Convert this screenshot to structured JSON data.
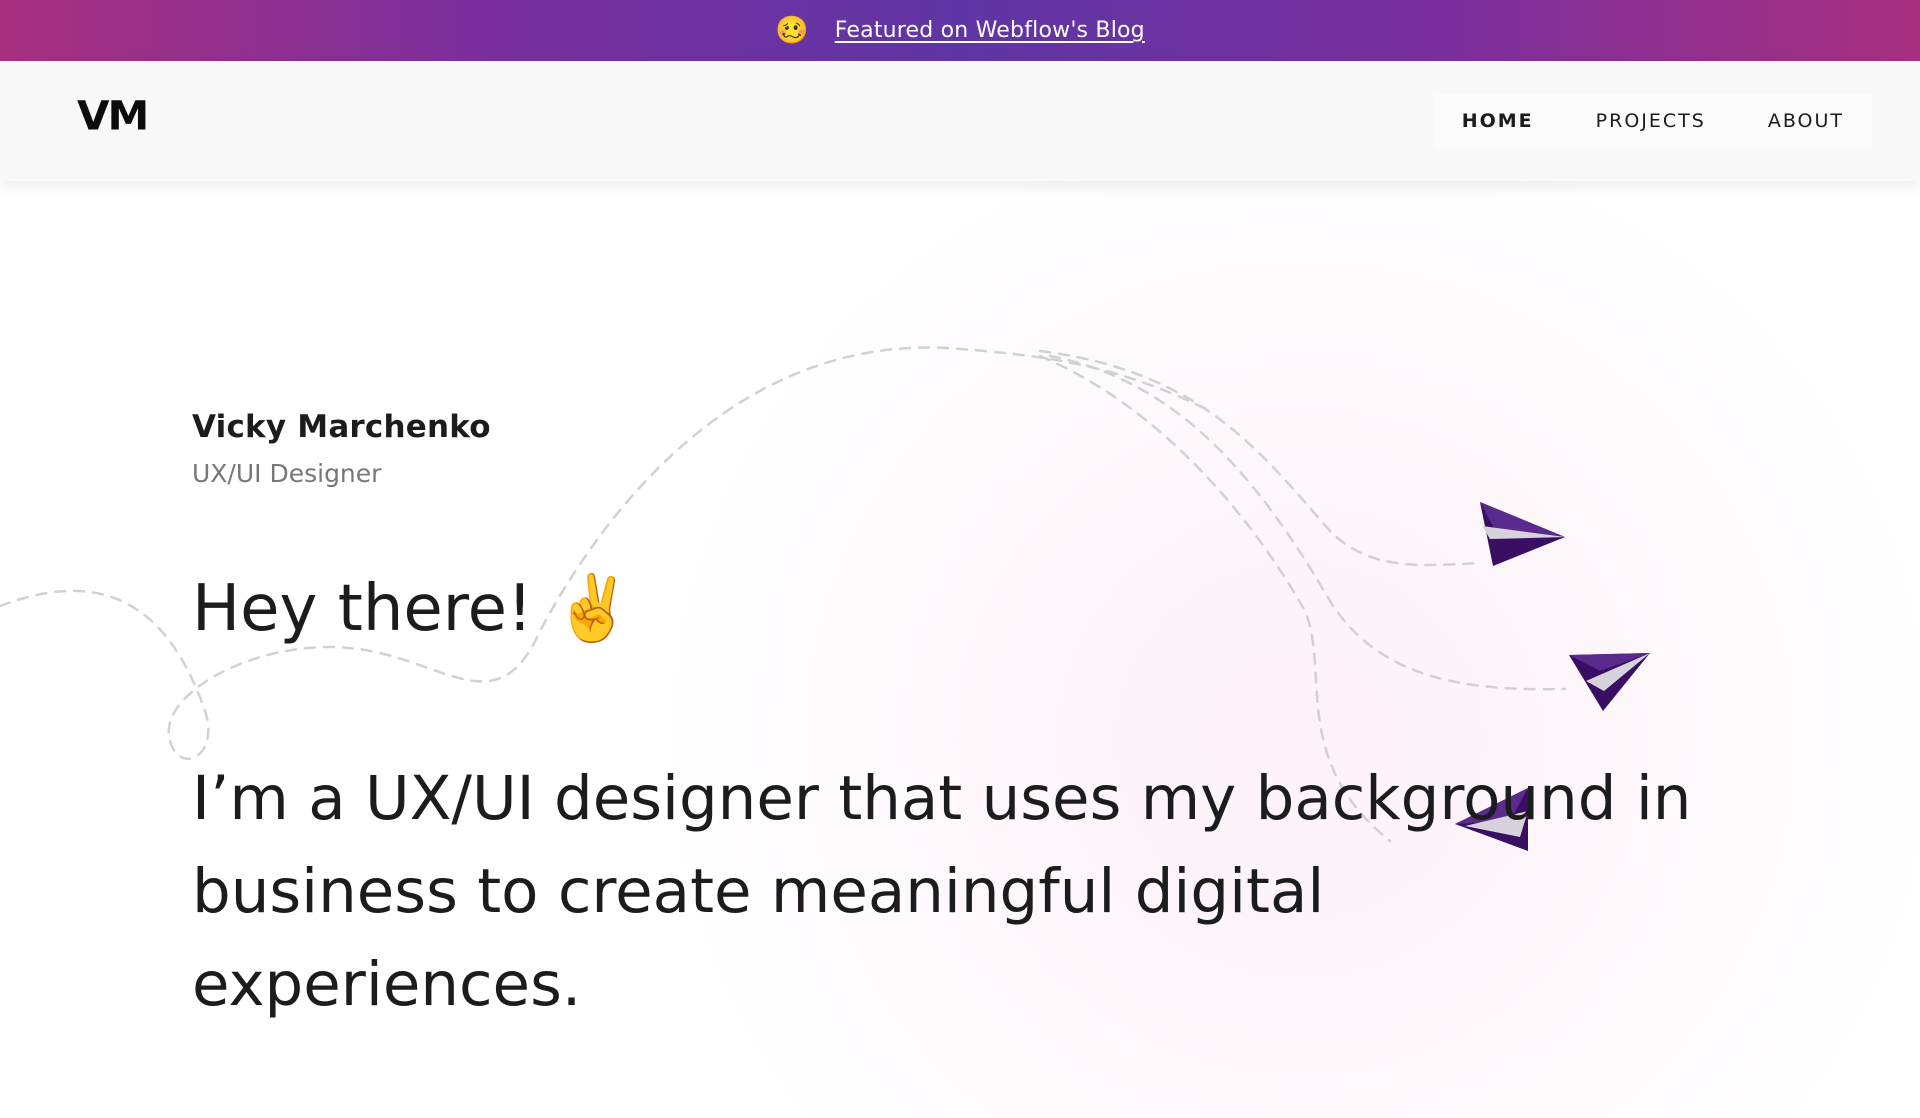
{
  "banner": {
    "emoji": "🥴",
    "link_text": "Featured on Webflow's Blog"
  },
  "header": {
    "logo": "VM",
    "nav": [
      {
        "label": "HOME",
        "active": true
      },
      {
        "label": "PROJECTS",
        "active": false
      },
      {
        "label": "ABOUT",
        "active": false
      }
    ]
  },
  "hero": {
    "name": "Vicky Marchenko",
    "role": "UX/UI Designer",
    "greeting": "Hey there! ✌️",
    "intro": "I’m a UX/UI designer that uses my background in business to create meaningful digital experiences."
  },
  "colors": {
    "banner_gradient": [
      "#a8307f",
      "#5f35a5"
    ],
    "plane_dark": "#3a0f63",
    "plane_mid": "#5a2a8c",
    "plane_light": "#d7d3dd",
    "dash_path": "#d2d0d5"
  },
  "icons": [
    "paper-plane-icon",
    "paper-plane-icon",
    "paper-plane-icon"
  ]
}
